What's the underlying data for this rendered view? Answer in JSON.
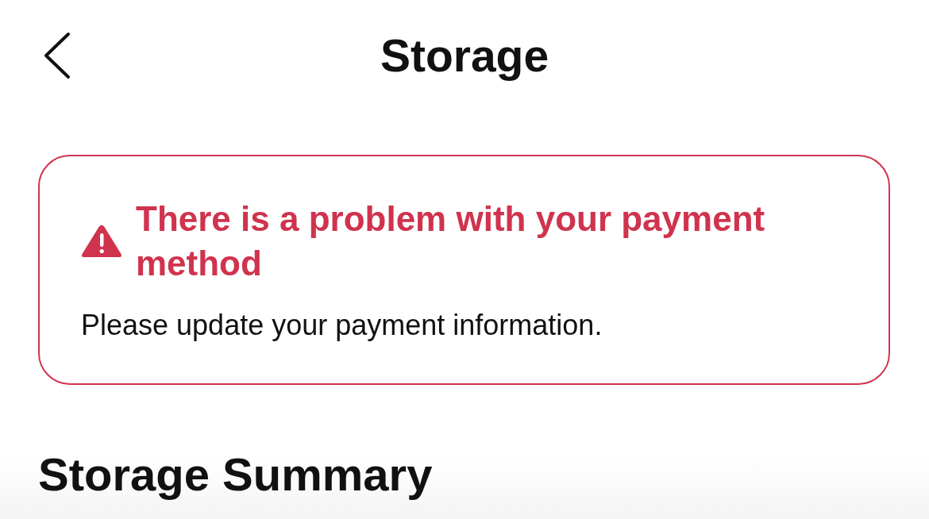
{
  "header": {
    "title": "Storage"
  },
  "alert": {
    "kind": "error",
    "title": "There is a problem with your payment method",
    "message": "Please update your payment information."
  },
  "section": {
    "title": "Storage Summary"
  }
}
